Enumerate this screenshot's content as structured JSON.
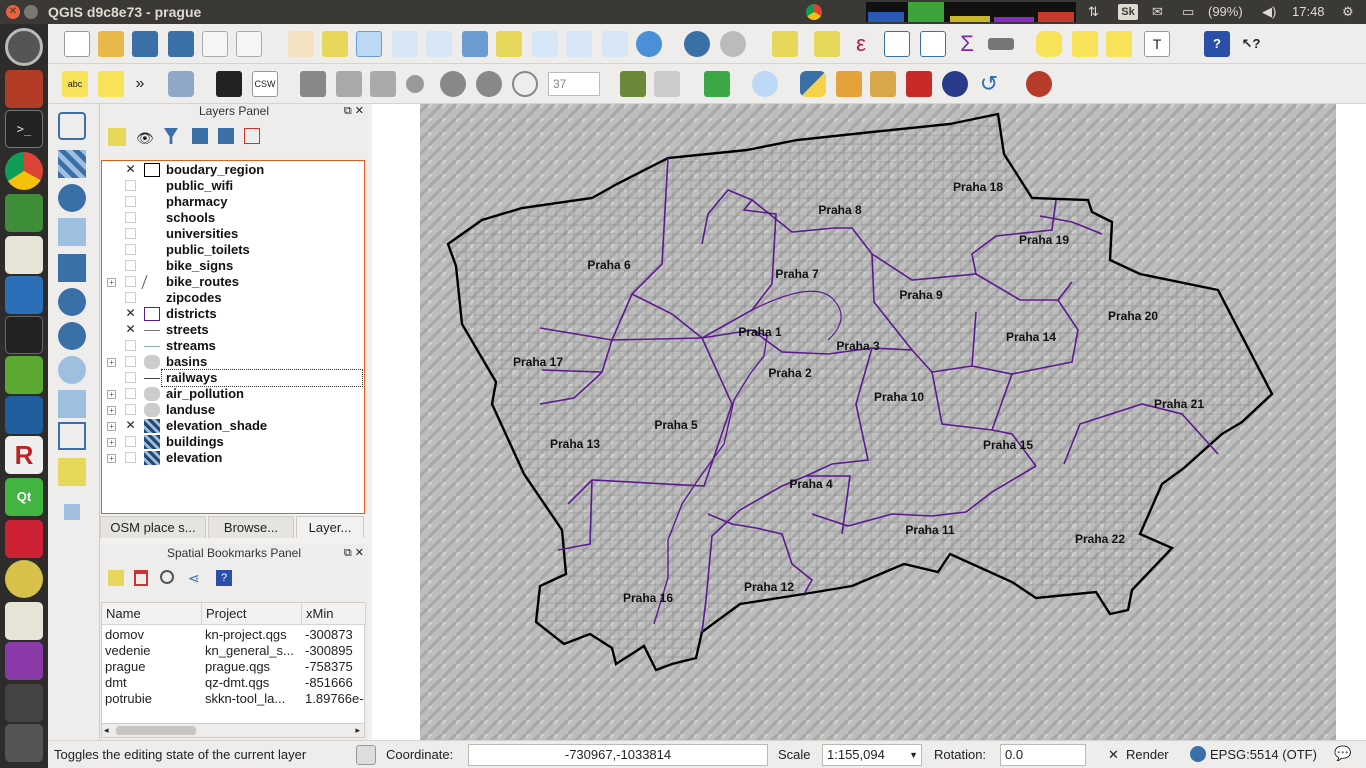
{
  "window": {
    "title": "QGIS d9c8e73 - prague"
  },
  "tray": {
    "battery": "(99%)",
    "time": "17:48",
    "lang_badge": "Sk"
  },
  "toolbar": {
    "label_tool": "abc",
    "csw": "CSW",
    "spin_value": "37",
    "overflow": "»"
  },
  "layers_panel": {
    "title": "Layers Panel",
    "layers": [
      {
        "name": "boudary_region",
        "checked": "✕",
        "expand": ""
      },
      {
        "name": "public_wifi",
        "checked": "",
        "expand": ""
      },
      {
        "name": "pharmacy",
        "checked": "",
        "expand": ""
      },
      {
        "name": "schools",
        "checked": "",
        "expand": ""
      },
      {
        "name": "universities",
        "checked": "",
        "expand": ""
      },
      {
        "name": "public_toilets",
        "checked": "",
        "expand": ""
      },
      {
        "name": "bike_signs",
        "checked": "",
        "expand": ""
      },
      {
        "name": "bike_routes",
        "checked": "",
        "expand": "+"
      },
      {
        "name": "zipcodes",
        "checked": "",
        "expand": ""
      },
      {
        "name": "districts",
        "checked": "✕",
        "expand": ""
      },
      {
        "name": "streets",
        "checked": "✕",
        "expand": ""
      },
      {
        "name": "streams",
        "checked": "",
        "expand": ""
      },
      {
        "name": "basins",
        "checked": "",
        "expand": "+"
      },
      {
        "name": "railways",
        "checked": "",
        "expand": ""
      },
      {
        "name": "air_pollution",
        "checked": "",
        "expand": "+"
      },
      {
        "name": "landuse",
        "checked": "",
        "expand": "+"
      },
      {
        "name": "elevation_shade",
        "checked": "✕",
        "expand": "+"
      },
      {
        "name": "buildings",
        "checked": "",
        "expand": "+"
      },
      {
        "name": "elevation",
        "checked": "",
        "expand": "+"
      }
    ]
  },
  "panel_tabs": [
    "OSM place s...",
    "Browse...",
    "Layer..."
  ],
  "bookmarks_panel": {
    "title": "Spatial Bookmarks Panel",
    "columns": [
      "Name",
      "Project",
      "xMin"
    ],
    "rows": [
      [
        "domov",
        "kn-project.qgs",
        "-300873"
      ],
      [
        "vedenie",
        "kn_general_s...",
        "-300895"
      ],
      [
        "prague",
        "prague.qgs",
        "-758375"
      ],
      [
        "dmt",
        "qz-dmt.qgs",
        "-851666"
      ],
      [
        "potrubie",
        "skkn-tool_la...",
        "1.89766e-"
      ]
    ]
  },
  "map": {
    "districts": [
      "Praha 1",
      "Praha 2",
      "Praha 3",
      "Praha 4",
      "Praha 5",
      "Praha 6",
      "Praha 7",
      "Praha 8",
      "Praha 9",
      "Praha 10",
      "Praha 11",
      "Praha 12",
      "Praha 13",
      "Praha 14",
      "Praha 15",
      "Praha 16",
      "Praha 17",
      "Praha 18",
      "Praha 19",
      "Praha 20",
      "Praha 21",
      "Praha 22"
    ],
    "boundary_color": "#000000",
    "district_color": "#5b1a8e"
  },
  "statusbar": {
    "message": "Toggles the editing state of the current layer",
    "coordinate_label": "Coordinate:",
    "coordinate_value": "-730967,-1033814",
    "scale_label": "Scale",
    "scale_value": "1:155,094",
    "rotation_label": "Rotation:",
    "rotation_value": "0.0",
    "render_label": "Render",
    "render_checked": "✕",
    "crs": "EPSG:5514 (OTF)"
  },
  "colors": {
    "accent": "#e25d22",
    "dark_bar": "#3a3935",
    "launcher": "#2e2c2a"
  }
}
